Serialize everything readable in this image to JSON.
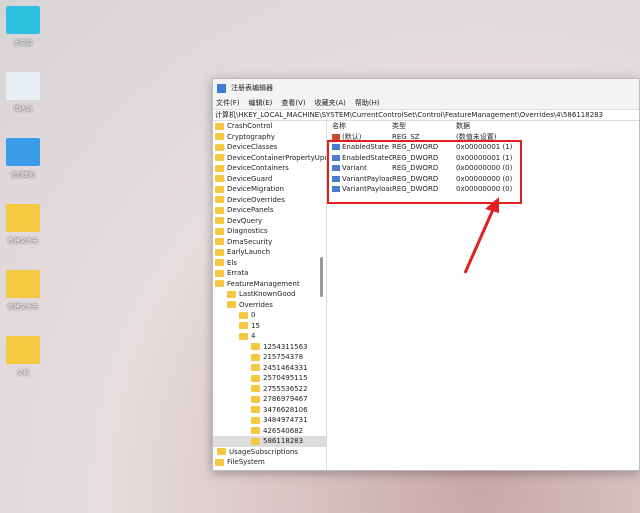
{
  "desktop": [
    "此电脑",
    "回收站",
    "控制面板",
    "新建文件夹",
    "新建文件夹",
    "文档"
  ],
  "window": {
    "title": "注册表编辑器",
    "menu": [
      "文件(F)",
      "编辑(E)",
      "查看(V)",
      "收藏夹(A)",
      "帮助(H)"
    ],
    "address": "计算机\\HKEY_LOCAL_MACHINE\\SYSTEM\\CurrentControlSet\\Control\\FeatureManagement\\Overrides\\4\\586118283",
    "tree": [
      "CrashControl",
      "Cryptography",
      "DeviceClasses",
      "DeviceContainerPropertyUpda",
      "DeviceContainers",
      "DeviceGuard",
      "DeviceMigration",
      "DeviceOverrides",
      "DevicePanels",
      "DevQuery",
      "Diagnostics",
      "DmaSecurity",
      "EarlyLaunch",
      "Els",
      "Errata",
      "FeatureManagement",
      "LastKnownGood",
      "Overrides",
      "0",
      "15",
      "4",
      "1254311563",
      "215754378",
      "2451464331",
      "2570495115",
      "2755536522",
      "2786979467",
      "3476628106",
      "3484974731",
      "426540682",
      "586118283",
      "UsageSubscriptions",
      "FileSystem"
    ],
    "headers": [
      "名称",
      "类型",
      "数据"
    ],
    "values": [
      {
        "name": "(默认)",
        "type": "REG_SZ",
        "data": "(数值未设置)"
      },
      {
        "name": "EnabledState",
        "type": "REG_DWORD",
        "data": "0x00000001 (1)"
      },
      {
        "name": "EnabledStateO...",
        "type": "REG_DWORD",
        "data": "0x00000001 (1)"
      },
      {
        "name": "Variant",
        "type": "REG_DWORD",
        "data": "0x00000000 (0)"
      },
      {
        "name": "VariantPayload",
        "type": "REG_DWORD",
        "data": "0x00000000 (0)"
      },
      {
        "name": "VariantPayload...",
        "type": "REG_DWORD",
        "data": "0x00000000 (0)"
      }
    ]
  },
  "highlight_color": "#e02020"
}
